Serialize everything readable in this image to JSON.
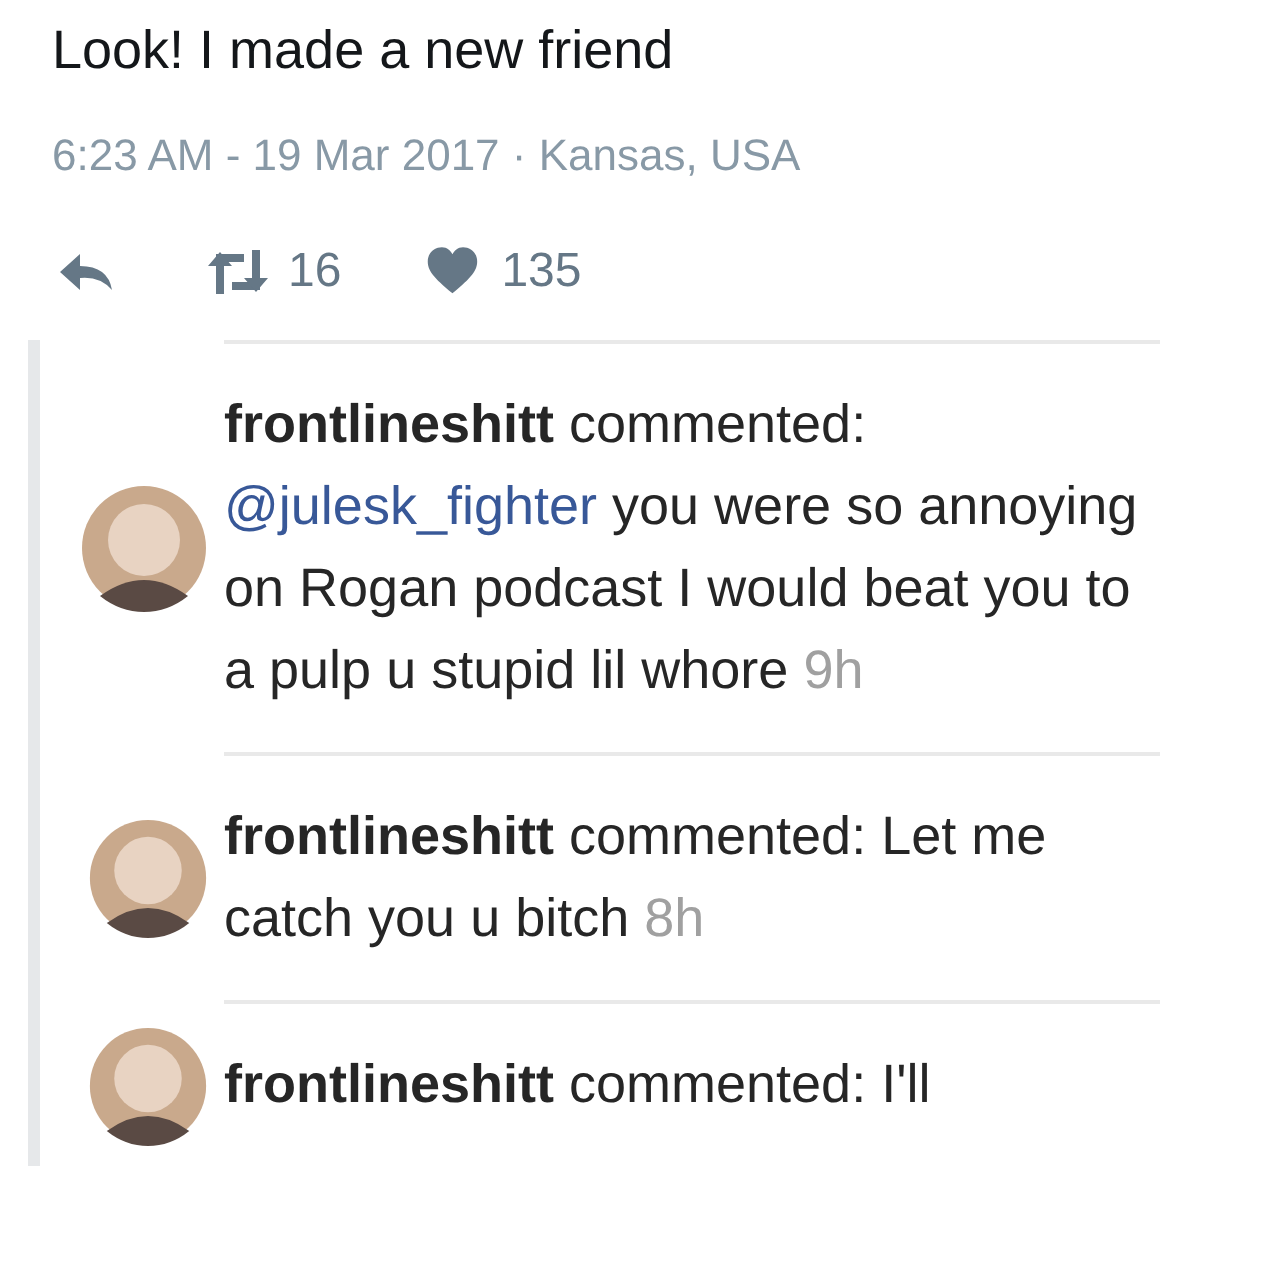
{
  "tweet": {
    "text": "Look! I made a new friend",
    "meta": "6:23 AM - 19 Mar 2017 · Kansas, USA",
    "retweets": "16",
    "likes": "135"
  },
  "comments": [
    {
      "user": "frontlineshitt",
      "action": "commented:",
      "mention": "@julesk_fighter",
      "body": "you were so annoying on Rogan podcast I would beat you to a pulp u stupid lil whore",
      "time": "9h"
    },
    {
      "user": "frontlineshitt",
      "action": "commented:",
      "body": "Let me catch you u bitch",
      "time": "8h"
    },
    {
      "user": "frontlineshitt",
      "action": "commented:",
      "body": "I'll"
    }
  ]
}
